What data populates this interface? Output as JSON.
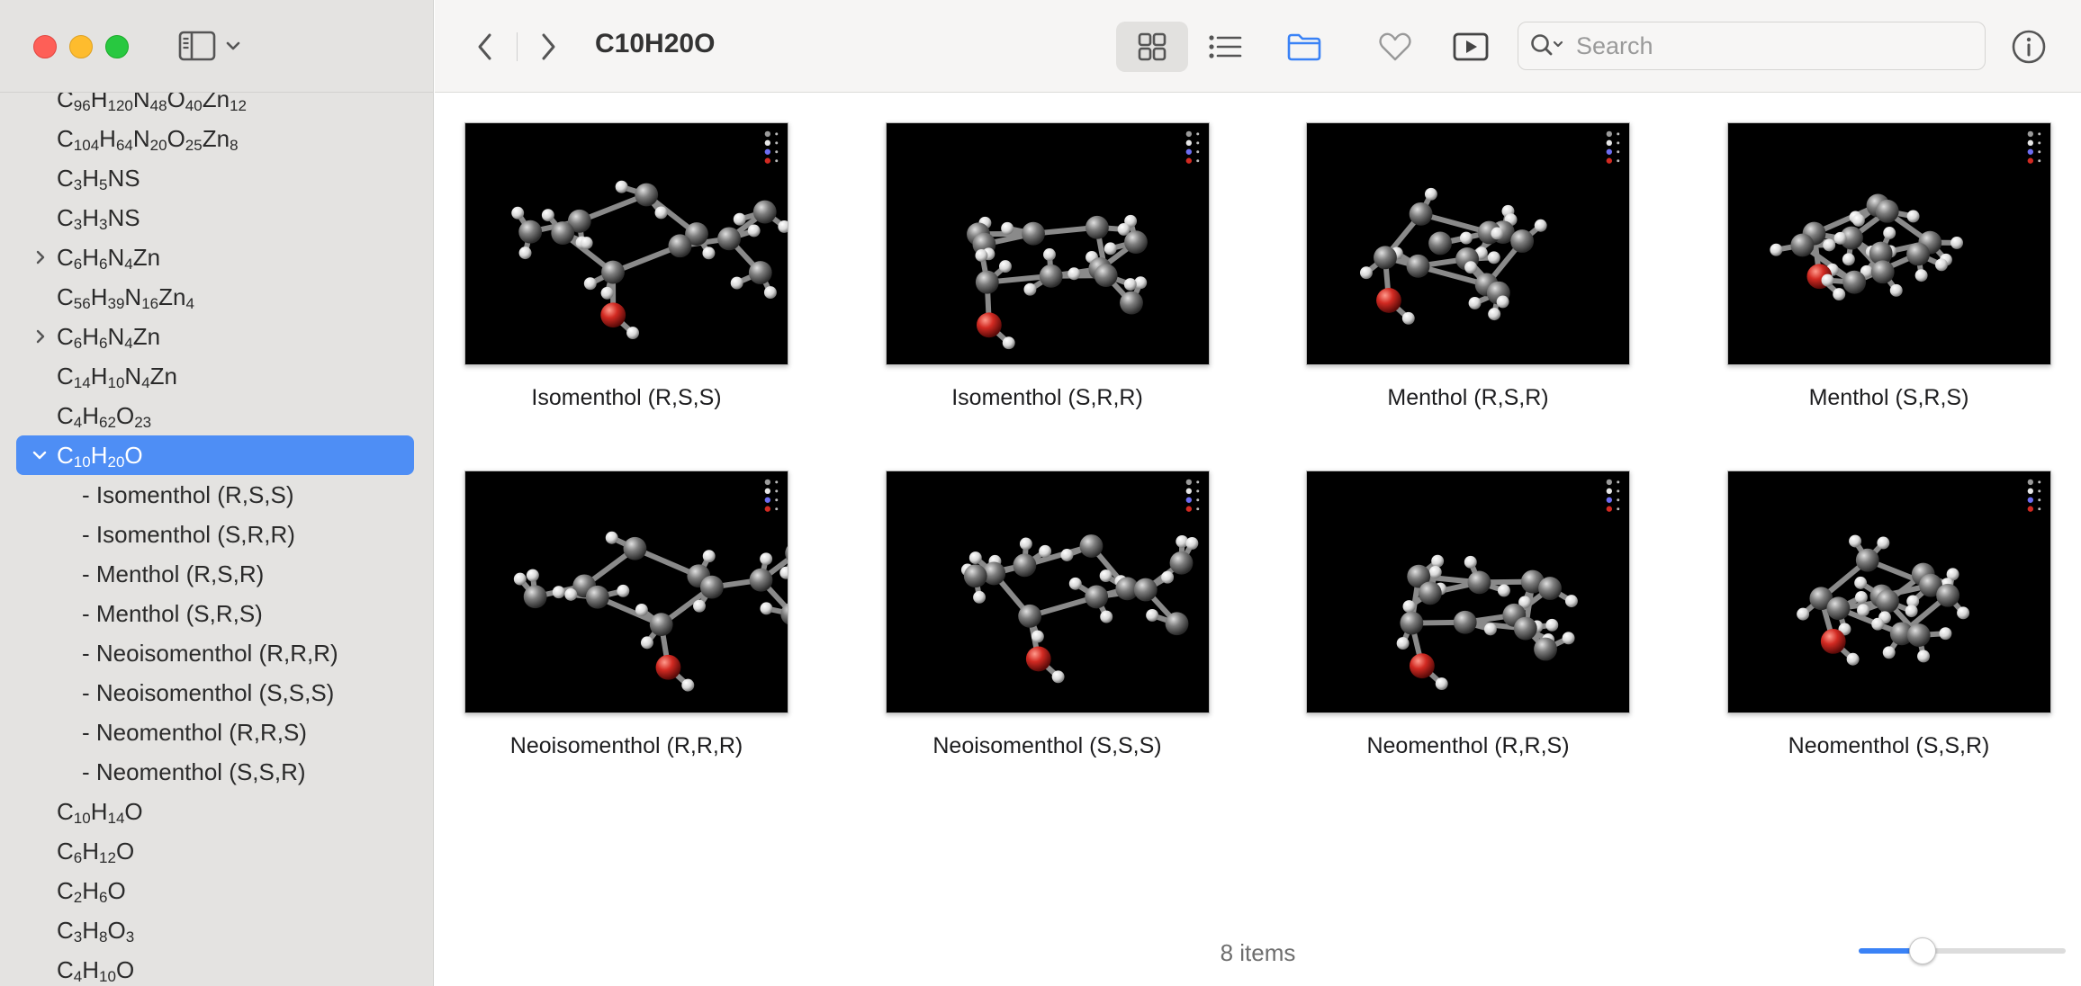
{
  "window": {
    "title": "C10H20O"
  },
  "toolbar": {
    "search_placeholder": "Search"
  },
  "sidebar": {
    "items": [
      {
        "label": "C₉₆H₁₂₀N₄₈O₄₀Zn₁₂",
        "type": "item"
      },
      {
        "label": "C₁₀₄H₆₄N₂₀O₂₅Zn₈",
        "type": "item"
      },
      {
        "label": "C₃H₅NS",
        "type": "item"
      },
      {
        "label": "C₃H₃NS",
        "type": "item"
      },
      {
        "label": "C₆H₆N₄Zn",
        "type": "collapsed"
      },
      {
        "label": "C₅₆H₃₉N₁₆Zn₄",
        "type": "item"
      },
      {
        "label": "C₆H₆N₄Zn",
        "type": "collapsed"
      },
      {
        "label": "C₁₄H₁₀N₄Zn",
        "type": "item"
      },
      {
        "label": "C₄H₆₂O₂₃",
        "type": "item"
      },
      {
        "label": "C₁₀H₂₀O",
        "type": "selected"
      },
      {
        "label": "- Isomenthol (R,S,S)",
        "type": "child"
      },
      {
        "label": "- Isomenthol (S,R,R)",
        "type": "child"
      },
      {
        "label": "- Menthol (R,S,R)",
        "type": "child"
      },
      {
        "label": "- Menthol (S,R,S)",
        "type": "child"
      },
      {
        "label": "- Neoisomenthol (R,R,R)",
        "type": "child"
      },
      {
        "label": "- Neoisomenthol (S,S,S)",
        "type": "child"
      },
      {
        "label": "- Neomenthol (R,R,S)",
        "type": "child"
      },
      {
        "label": "- Neomenthol (S,S,R)",
        "type": "child"
      },
      {
        "label": "C₁₀H₁₄O",
        "type": "item"
      },
      {
        "label": "C₆H₁₂O",
        "type": "item"
      },
      {
        "label": "C₂H₆O",
        "type": "item"
      },
      {
        "label": "C₃H₈O₃",
        "type": "item"
      },
      {
        "label": "C₄H₁₀O",
        "type": "item"
      }
    ]
  },
  "grid": {
    "items": [
      {
        "label": "Isomenthol (R,S,S)"
      },
      {
        "label": "Isomenthol (S,R,R)"
      },
      {
        "label": "Menthol (R,S,R)"
      },
      {
        "label": "Menthol (S,R,S)"
      },
      {
        "label": "Neoisomenthol (R,R,R)"
      },
      {
        "label": "Neoisomenthol (S,S,S)"
      },
      {
        "label": "Neomenthol (R,R,S)"
      },
      {
        "label": "Neomenthol (S,S,R)"
      }
    ]
  },
  "status": {
    "count_label": "8 items"
  },
  "zoom": {
    "level": 0.25
  },
  "colors": {
    "accent": "#4e8ef5",
    "oxygen": "#d22a22",
    "carbon": "#7a7a7a",
    "hydrogen": "#e8e8e8"
  }
}
